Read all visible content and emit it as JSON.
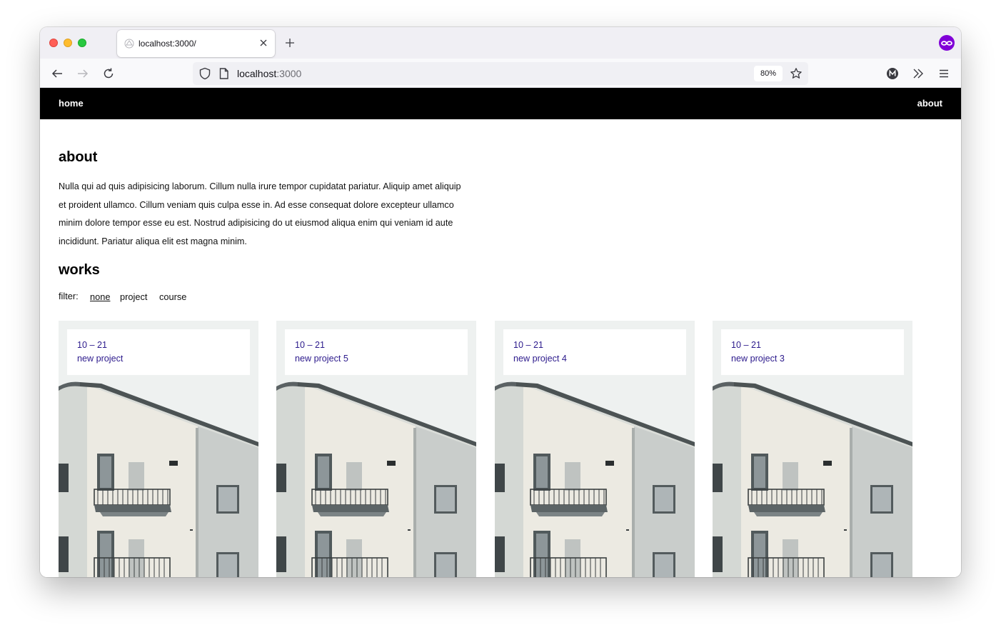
{
  "browser": {
    "tab_title": "localhost:3000/",
    "url_host": "localhost",
    "url_port": ":3000",
    "zoom": "80%",
    "profile_initial": "M"
  },
  "site": {
    "nav": {
      "home": "home",
      "about": "about"
    },
    "about": {
      "heading": "about",
      "paragraph": "Nulla qui ad quis adipisicing laborum. Cillum nulla irure tempor cupidatat pariatur. Aliquip amet aliquip et proident ullamco. Cillum veniam quis culpa esse in. Ad esse consequat dolore excepteur ullamco minim dolore tempor esse eu est. Nostrud adipisicing do ut eiusmod aliqua enim qui veniam id aute incididunt. Pariatur aliqua elit est magna minim."
    },
    "works": {
      "heading": "works",
      "filter_label": "filter:",
      "filters": [
        "none",
        "project",
        "course"
      ],
      "active_filter": "none",
      "cards": [
        {
          "date": "10 – 21",
          "title": "new project"
        },
        {
          "date": "10 – 21",
          "title": "new project 5"
        },
        {
          "date": "10 – 21",
          "title": "new project 4"
        },
        {
          "date": "10 – 21",
          "title": "new project 3"
        }
      ]
    }
  },
  "colors": {
    "nav_bg": "#000000",
    "card_text": "#2c1a8c",
    "ext_purple": "#8000d7"
  }
}
